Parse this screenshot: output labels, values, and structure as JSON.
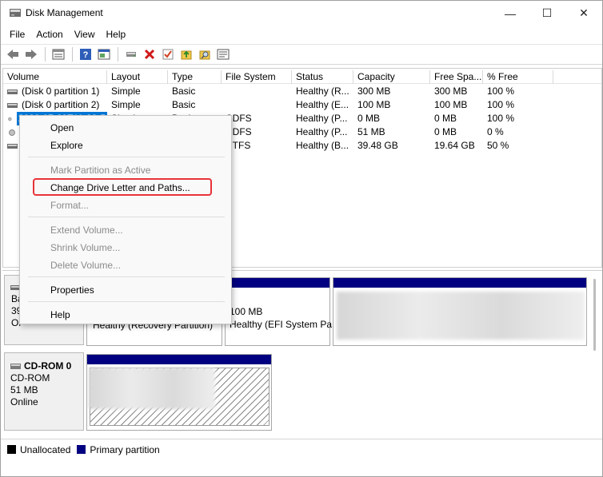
{
  "window": {
    "title": "Disk Management",
    "controls": {
      "minimize": "—",
      "maximize": "☐",
      "close": "✕"
    }
  },
  "menu": [
    "File",
    "Action",
    "View",
    "Help"
  ],
  "toolbar": {
    "icons": [
      "back-arrow-icon",
      "forward-arrow-icon",
      "list-view-icon",
      "help-icon",
      "console-icon",
      "connect-icon",
      "delete-icon",
      "check-icon",
      "up-folder-icon",
      "search-icon",
      "properties-icon"
    ]
  },
  "columns": [
    "Volume",
    "Layout",
    "Type",
    "File System",
    "Status",
    "Capacity",
    "Free Spa...",
    "% Free"
  ],
  "rows": [
    {
      "volume": "(Disk 0 partition 1)",
      "layout": "Simple",
      "type": "Basic",
      "fs": "",
      "status": "Healthy (R...",
      "capacity": "300 MB",
      "free": "300 MB",
      "pct": "100 %"
    },
    {
      "volume": "(Disk 0 partition 2)",
      "layout": "Simple",
      "type": "Basic",
      "fs": "",
      "status": "Healthy (E...",
      "capacity": "100 MB",
      "free": "100 MB",
      "pct": "100 %"
    },
    {
      "volume": "2022-07-29T11-33-5",
      "layout": "Simple",
      "type": "Basic",
      "fs": "CDFS",
      "status": "Healthy (P...",
      "capacity": "0 MB",
      "free": "0 MB",
      "pct": "100 %"
    },
    {
      "volume": "",
      "layout": "",
      "type": "",
      "fs": "CDFS",
      "status": "Healthy (P...",
      "capacity": "51 MB",
      "free": "0 MB",
      "pct": "0 %"
    },
    {
      "volume": "",
      "layout": "",
      "type": "",
      "fs": "NTFS",
      "status": "Healthy (B...",
      "capacity": "39.48 GB",
      "free": "19.64 GB",
      "pct": "50 %"
    }
  ],
  "context_menu": {
    "open": "Open",
    "explore": "Explore",
    "mark_active": "Mark Partition as Active",
    "change_letter": "Change Drive Letter and Paths...",
    "format": "Format...",
    "extend": "Extend Volume...",
    "shrink": "Shrink Volume...",
    "delete": "Delete Volume...",
    "properties": "Properties",
    "help": "Help"
  },
  "disk0": {
    "label_partial_1": "Ba",
    "label_partial_2": "39",
    "label_partial_3": "Or",
    "part1_status": "Healthy (Recovery Partition)",
    "part2_size": "100 MB",
    "part2_status": "Healthy (EFI System Pa"
  },
  "cdrom": {
    "name": "CD-ROM 0",
    "type": "CD-ROM",
    "size": "51 MB",
    "status": "Online"
  },
  "legend": {
    "unallocated": "Unallocated",
    "primary": "Primary partition",
    "colors": {
      "unallocated": "#000000",
      "primary": "#000080"
    }
  }
}
